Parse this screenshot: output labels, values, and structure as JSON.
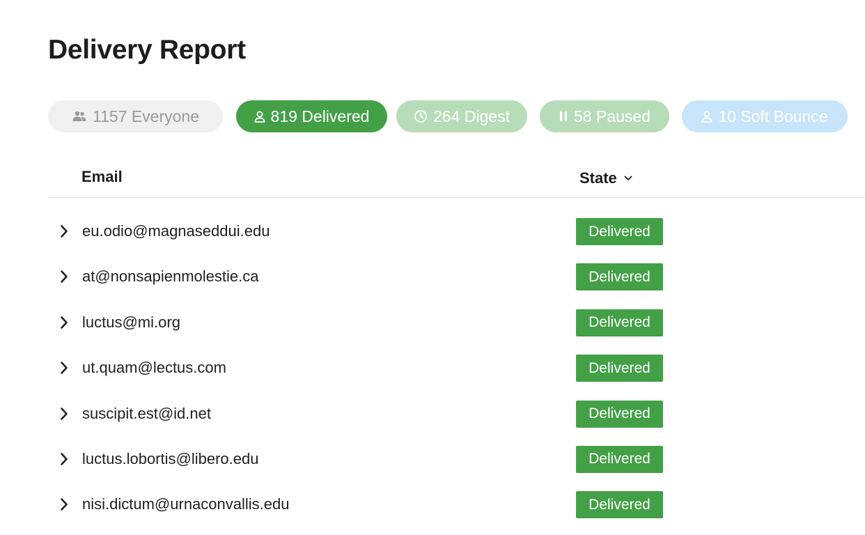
{
  "page": {
    "title": "Delivery Report"
  },
  "filters": [
    {
      "id": "everyone",
      "label": "1157 Everyone",
      "icon": "people-icon"
    },
    {
      "id": "delivered",
      "label": "819 Delivered",
      "icon": "person-icon",
      "active": true
    },
    {
      "id": "digest",
      "label": "264 Digest",
      "icon": "clock-icon"
    },
    {
      "id": "paused",
      "label": "58 Paused",
      "icon": "pause-icon"
    },
    {
      "id": "softbounce",
      "label": "10 Soft Bounce",
      "icon": "person-icon"
    }
  ],
  "table": {
    "columns": {
      "email": "Email",
      "state": "State"
    },
    "rows": [
      {
        "email": "eu.odio@magnaseddui.edu",
        "state": "Delivered"
      },
      {
        "email": "at@nonsapienmolestie.ca",
        "state": "Delivered"
      },
      {
        "email": "luctus@mi.org",
        "state": "Delivered"
      },
      {
        "email": "ut.quam@lectus.com",
        "state": "Delivered"
      },
      {
        "email": "suscipit.est@id.net",
        "state": "Delivered"
      },
      {
        "email": "luctus.lobortis@libero.edu",
        "state": "Delivered"
      },
      {
        "email": "nisi.dictum@urnaconvallis.edu",
        "state": "Delivered"
      }
    ]
  },
  "colors": {
    "delivered": "#43a047",
    "digest": "#b7ddb8",
    "paused": "#b7ddb8",
    "softbounce": "#c7e4fb",
    "everyone": "#f0f0f0"
  }
}
